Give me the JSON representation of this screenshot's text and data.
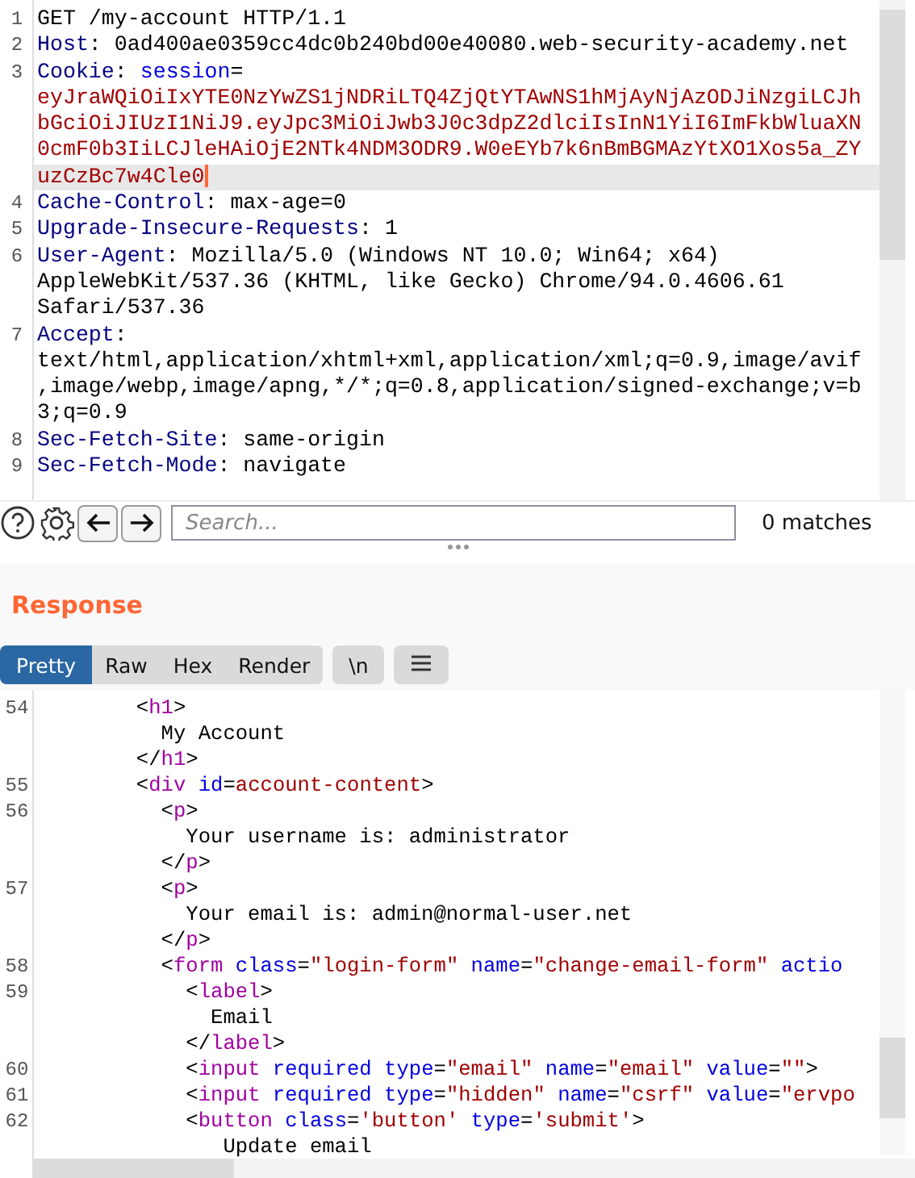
{
  "request": {
    "rows": [
      {
        "number": "1",
        "current": false,
        "segments": [
          {
            "kind": "plain",
            "text": "GET /my-account HTTP/1.1"
          }
        ]
      },
      {
        "number": "2",
        "current": false,
        "segments": [
          {
            "kind": "name",
            "text": "Host"
          },
          {
            "kind": "plain",
            "text": ": 0ad400ae0359cc4dc0b240bd00e40080.web-security-academy.net"
          }
        ]
      },
      {
        "number": "3",
        "current": false,
        "segments": [
          {
            "kind": "name",
            "text": "Cookie"
          },
          {
            "kind": "plain",
            "text": ": "
          },
          {
            "kind": "key",
            "text": "session"
          },
          {
            "kind": "plain",
            "text": "="
          }
        ]
      },
      {
        "current": false,
        "segments": [
          {
            "kind": "value",
            "text": "eyJraWQiOiIxYTE0NzYwZS1jNDRiLTQ4ZjQtYTAwNS1hMjAyNjAzODJiNzgiLCJh"
          }
        ]
      },
      {
        "current": false,
        "segments": [
          {
            "kind": "value",
            "text": "bGciOiJIUzI1NiJ9.eyJpc3MiOiJwb3J0c3dpZ2dlciIsInN1YiI6ImFkbWluaXN"
          }
        ]
      },
      {
        "current": false,
        "segments": [
          {
            "kind": "value",
            "text": "0cmF0b3IiLCJleHAiOjE2NTk4NDM3ODR9.W0eEYb7k6nBmBGMAzYtXO1Xos5a_ZY"
          }
        ]
      },
      {
        "current": true,
        "segments": [
          {
            "kind": "value",
            "text": "uzCzBc7w4Cle0"
          }
        ]
      },
      {
        "number": "4",
        "current": false,
        "segments": [
          {
            "kind": "name",
            "text": "Cache-Control"
          },
          {
            "kind": "plain",
            "text": ": max-age=0"
          }
        ]
      },
      {
        "number": "5",
        "current": false,
        "segments": [
          {
            "kind": "name",
            "text": "Upgrade-Insecure-Requests"
          },
          {
            "kind": "plain",
            "text": ": 1"
          }
        ]
      },
      {
        "number": "6",
        "current": false,
        "segments": [
          {
            "kind": "name",
            "text": "User-Agent"
          },
          {
            "kind": "plain",
            "text": ": Mozilla/5.0 (Windows NT 10.0; Win64; x64)"
          }
        ]
      },
      {
        "current": false,
        "segments": [
          {
            "kind": "plain",
            "text": "AppleWebKit/537.36 (KHTML, like Gecko) Chrome/94.0.4606.61"
          }
        ]
      },
      {
        "current": false,
        "segments": [
          {
            "kind": "plain",
            "text": "Safari/537.36"
          }
        ]
      },
      {
        "number": "7",
        "current": false,
        "segments": [
          {
            "kind": "name",
            "text": "Accept"
          },
          {
            "kind": "plain",
            "text": ":"
          }
        ]
      },
      {
        "current": false,
        "segments": [
          {
            "kind": "plain",
            "text": "text/html,application/xhtml+xml,application/xml;q=0.9,image/avif"
          }
        ]
      },
      {
        "current": false,
        "segments": [
          {
            "kind": "plain",
            "text": ",image/webp,image/apng,*/*;q=0.8,application/signed-exchange;v=b"
          }
        ]
      },
      {
        "current": false,
        "segments": [
          {
            "kind": "plain",
            "text": "3;q=0.9"
          }
        ]
      },
      {
        "number": "8",
        "current": false,
        "segments": [
          {
            "kind": "name",
            "text": "Sec-Fetch-Site"
          },
          {
            "kind": "plain",
            "text": ": same-origin"
          }
        ]
      },
      {
        "number": "9",
        "current": false,
        "segments": [
          {
            "kind": "name",
            "text": "Sec-Fetch-Mode"
          },
          {
            "kind": "plain",
            "text": ": navigate"
          }
        ]
      }
    ]
  },
  "search": {
    "placeholder": "Search...",
    "matches": "0 matches"
  },
  "response": {
    "title": "Response",
    "tabs": [
      {
        "label": "Pretty",
        "selected": true
      },
      {
        "label": "Raw",
        "selected": false
      },
      {
        "label": "Hex",
        "selected": false
      },
      {
        "label": "Render",
        "selected": false
      }
    ],
    "newline_button": "\\n",
    "rows": [
      {
        "number": "54",
        "segments": [
          {
            "kind": "plain",
            "text": "        <"
          },
          {
            "kind": "tag",
            "text": "h1"
          },
          {
            "kind": "plain",
            "text": ">"
          }
        ]
      },
      {
        "segments": [
          {
            "kind": "plain",
            "text": "          My Account"
          }
        ]
      },
      {
        "segments": [
          {
            "kind": "plain",
            "text": "        </"
          },
          {
            "kind": "tag",
            "text": "h1"
          },
          {
            "kind": "plain",
            "text": ">"
          }
        ]
      },
      {
        "number": "55",
        "segments": [
          {
            "kind": "plain",
            "text": "        <"
          },
          {
            "kind": "tag",
            "text": "div"
          },
          {
            "kind": "key",
            "text": " id"
          },
          {
            "kind": "plain",
            "text": "="
          },
          {
            "kind": "value",
            "text": "account-content"
          },
          {
            "kind": "plain",
            "text": ">"
          }
        ]
      },
      {
        "number": "56",
        "segments": [
          {
            "kind": "plain",
            "text": "          <"
          },
          {
            "kind": "tag",
            "text": "p"
          },
          {
            "kind": "plain",
            "text": ">"
          }
        ]
      },
      {
        "segments": [
          {
            "kind": "plain",
            "text": "            Your username is: administrator"
          }
        ]
      },
      {
        "segments": [
          {
            "kind": "plain",
            "text": "          </"
          },
          {
            "kind": "tag",
            "text": "p"
          },
          {
            "kind": "plain",
            "text": ">"
          }
        ]
      },
      {
        "number": "57",
        "segments": [
          {
            "kind": "plain",
            "text": "          <"
          },
          {
            "kind": "tag",
            "text": "p"
          },
          {
            "kind": "plain",
            "text": ">"
          }
        ]
      },
      {
        "segments": [
          {
            "kind": "plain",
            "text": "            Your email is: admin@normal-user.net"
          }
        ]
      },
      {
        "segments": [
          {
            "kind": "plain",
            "text": "          </"
          },
          {
            "kind": "tag",
            "text": "p"
          },
          {
            "kind": "plain",
            "text": ">"
          }
        ]
      },
      {
        "number": "58",
        "segments": [
          {
            "kind": "plain",
            "text": "          <"
          },
          {
            "kind": "tag",
            "text": "form"
          },
          {
            "kind": "key",
            "text": " class"
          },
          {
            "kind": "plain",
            "text": "="
          },
          {
            "kind": "value",
            "text": "\"login-form\""
          },
          {
            "kind": "key",
            "text": " name"
          },
          {
            "kind": "plain",
            "text": "="
          },
          {
            "kind": "value",
            "text": "\"change-email-form\""
          },
          {
            "kind": "key",
            "text": " actio"
          }
        ]
      },
      {
        "number": "59",
        "segments": [
          {
            "kind": "plain",
            "text": "            <"
          },
          {
            "kind": "tag",
            "text": "label"
          },
          {
            "kind": "plain",
            "text": ">"
          }
        ]
      },
      {
        "segments": [
          {
            "kind": "plain",
            "text": "              Email"
          }
        ]
      },
      {
        "segments": [
          {
            "kind": "plain",
            "text": "            </"
          },
          {
            "kind": "tag",
            "text": "label"
          },
          {
            "kind": "plain",
            "text": ">"
          }
        ]
      },
      {
        "number": "60",
        "segments": [
          {
            "kind": "plain",
            "text": "            <"
          },
          {
            "kind": "tag",
            "text": "input"
          },
          {
            "kind": "key",
            "text": " required type"
          },
          {
            "kind": "plain",
            "text": "="
          },
          {
            "kind": "value",
            "text": "\"email\""
          },
          {
            "kind": "key",
            "text": " name"
          },
          {
            "kind": "plain",
            "text": "="
          },
          {
            "kind": "value",
            "text": "\"email\""
          },
          {
            "kind": "key",
            "text": " value"
          },
          {
            "kind": "plain",
            "text": "="
          },
          {
            "kind": "value",
            "text": "\"\""
          },
          {
            "kind": "plain",
            "text": ">"
          }
        ]
      },
      {
        "number": "61",
        "segments": [
          {
            "kind": "plain",
            "text": "            <"
          },
          {
            "kind": "tag",
            "text": "input"
          },
          {
            "kind": "key",
            "text": " required type"
          },
          {
            "kind": "plain",
            "text": "="
          },
          {
            "kind": "value",
            "text": "\"hidden\""
          },
          {
            "kind": "key",
            "text": " name"
          },
          {
            "kind": "plain",
            "text": "="
          },
          {
            "kind": "value",
            "text": "\"csrf\""
          },
          {
            "kind": "key",
            "text": " value"
          },
          {
            "kind": "plain",
            "text": "="
          },
          {
            "kind": "value",
            "text": "\"ervpo"
          }
        ]
      },
      {
        "number": "62",
        "segments": [
          {
            "kind": "plain",
            "text": "            <"
          },
          {
            "kind": "tag",
            "text": "button"
          },
          {
            "kind": "key",
            "text": " class"
          },
          {
            "kind": "plain",
            "text": "="
          },
          {
            "kind": "value",
            "text": "'button'"
          },
          {
            "kind": "key",
            "text": " type"
          },
          {
            "kind": "plain",
            "text": "="
          },
          {
            "kind": "value",
            "text": "'submit'"
          },
          {
            "kind": "plain",
            "text": ">"
          }
        ]
      },
      {
        "segments": [
          {
            "kind": "plain",
            "text": "               Update email"
          }
        ]
      }
    ]
  }
}
